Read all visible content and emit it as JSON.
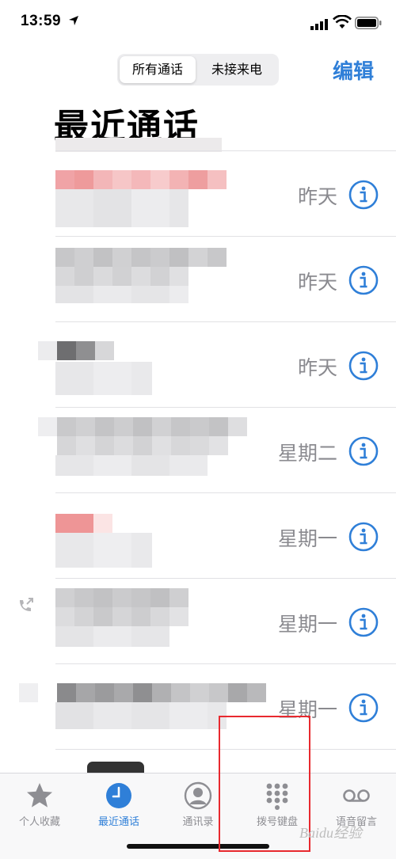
{
  "status_bar": {
    "time": "13:59"
  },
  "header": {
    "segments": [
      "所有通话",
      "未接来电"
    ],
    "edit_label": "编辑",
    "title": "最近通话"
  },
  "calls": [
    {
      "date": "昨天",
      "missed": true
    },
    {
      "date": "昨天",
      "missed": false
    },
    {
      "date": "昨天",
      "missed": false
    },
    {
      "date": "星期二",
      "missed": false
    },
    {
      "date": "星期一",
      "missed": true
    },
    {
      "date": "星期一",
      "missed": false,
      "outgoing": true
    },
    {
      "date": "星期一",
      "missed": false
    }
  ],
  "tab_bar": {
    "tabs": [
      {
        "label": "个人收藏",
        "icon": "star-icon"
      },
      {
        "label": "最近通话",
        "icon": "clock-icon",
        "active": true
      },
      {
        "label": "通讯录",
        "icon": "person-circle-icon"
      },
      {
        "label": "拨号键盘",
        "icon": "keypad-icon"
      },
      {
        "label": "语音留言",
        "icon": "voicemail-icon"
      }
    ]
  },
  "colors": {
    "accent": "#2f7fd8",
    "missed": "#e8292f",
    "secondary_text": "#8a8a8f"
  },
  "watermark": "Baidu经验"
}
